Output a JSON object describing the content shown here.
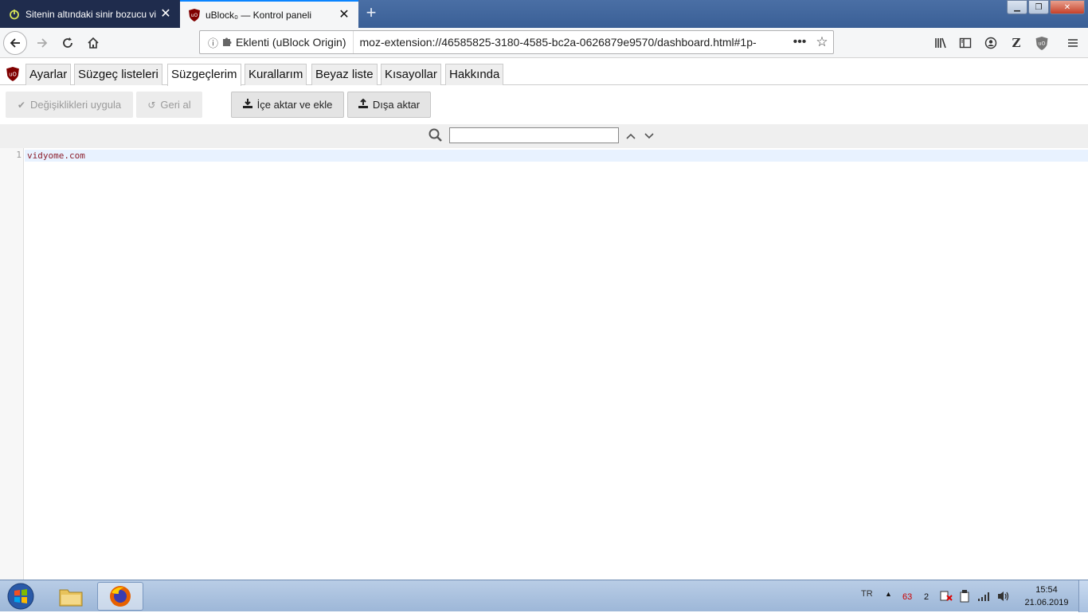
{
  "browser": {
    "tabs": [
      {
        "title": "Sitenin altındaki sinir bozucu vi",
        "close": "✕"
      },
      {
        "title": "uBlock₀ — Kontrol paneli",
        "close": "✕"
      }
    ],
    "newtab": "+",
    "window_controls": {
      "minimize": "▁",
      "maximize": "❐",
      "close": "✕"
    },
    "identity_label": "Eklenti (uBlock Origin)",
    "url": "moz-extension://46585825-3180-4585-bc2a-0626879e9570/dashboard.html#1p-",
    "page_actions": "•••",
    "star": "☆",
    "toolbar_z": "Z"
  },
  "dashboard": {
    "tabs": [
      "Ayarlar",
      "Süzgeç listeleri",
      "Süzgeçlerim",
      "Kurallarım",
      "Beyaz liste",
      "Kısayollar",
      "Hakkında"
    ],
    "active_tab": "Süzgeçlerim",
    "buttons": {
      "apply": "Değişiklikleri uygula",
      "revert": "Geri al",
      "import": "İçe aktar ve ekle",
      "export": "Dışa aktar"
    },
    "search": {
      "value": "",
      "up": "⌃",
      "down": "⌄"
    },
    "editor": {
      "lines": [
        {
          "num": "1",
          "text": "vidyome.com"
        }
      ]
    }
  },
  "taskbar": {
    "lang": "TR",
    "tray_count_red": "63",
    "tray_count": "2",
    "time": "15:54",
    "date": "21.06.2019"
  },
  "colors": {
    "accent": "#0a84ff",
    "ublock_red": "#800000",
    "code_text": "#8b1d2b"
  }
}
